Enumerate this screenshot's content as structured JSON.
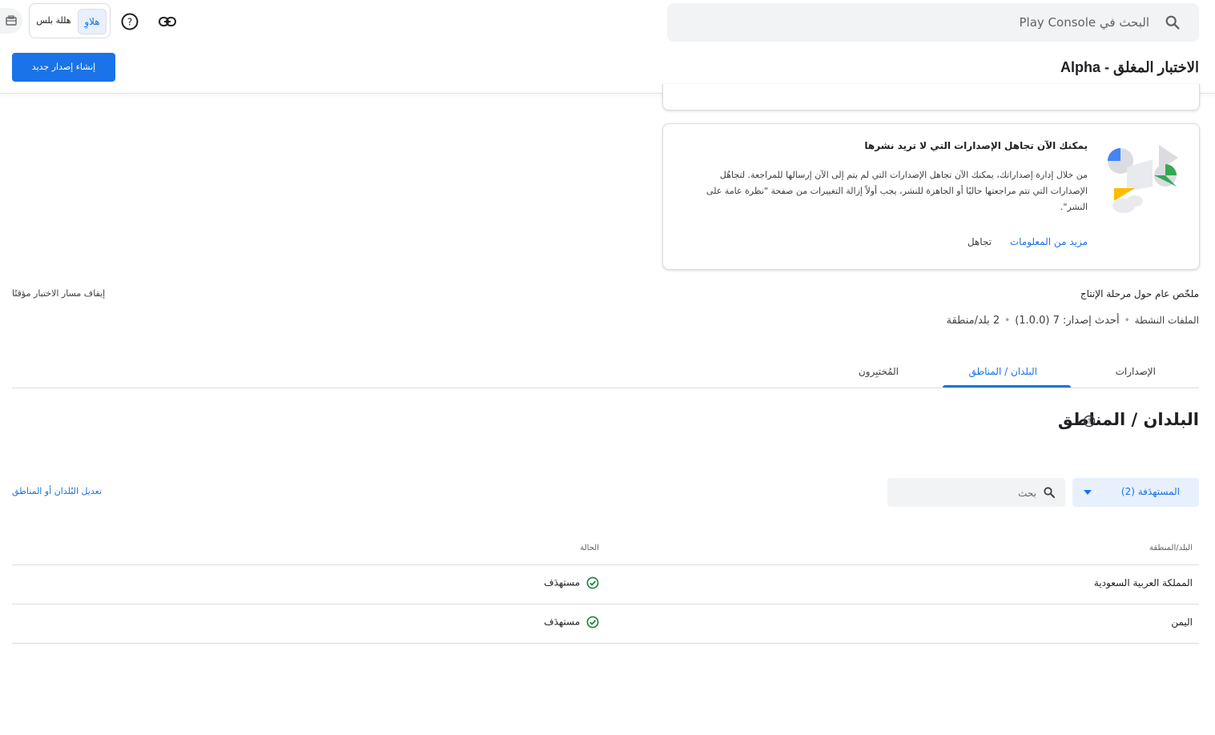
{
  "topbar": {
    "search_placeholder": "البحث في Play Console",
    "toggle_selected": "هلاوِ",
    "toggle_other": "هللة بلس",
    "icons": [
      "search-icon",
      "link-icon",
      "help-icon",
      "kit-icon"
    ]
  },
  "header": {
    "title": "الاختبار المغلق - Alpha",
    "create_button": "إنشاء إصدار جديد"
  },
  "info_card": {
    "title": "يمكنك الآن تجاهل الإصدارات التي لا تريد نشرها",
    "body": "من خلال إدارة إصداراتك، يمكنك الآن تجاهل الإصدارات التي لم يتم إلى الآن إرسالها للمراجعة. لتجاهُل الإصدارات التي تتم مراجعتها حاليًا أو الجاهزة للنشر، يجب أولاً إزالة التغييرات من صفحة \"نظرة عامة على النشر\".",
    "learn_more": "مزيد من المعلومات",
    "dismiss": "تجاهل"
  },
  "summary": {
    "title": "ملخّص عام حول مرحلة الإنتاج",
    "pause": "إيقاف مسار الاختبار مؤقتًا",
    "active_files": "الملفات النشطة",
    "latest_release": "أحدث إصدار: 7 (1.0.0)",
    "countries": "2 بلد/منطقة"
  },
  "tabs": {
    "releases": "الإصدارات",
    "countries": "البلدان / المناطق",
    "testers": "المُختبِرون",
    "active": "countries"
  },
  "section": {
    "title": "البلدان / المناطق"
  },
  "filters": {
    "select_value": "المستهدَفة (2)",
    "search_placeholder": "بحث",
    "edit_link": "تعديل البُلدان أو المناطق"
  },
  "table": {
    "headers": {
      "country": "البلد/المنطقة",
      "status": "الحالة"
    },
    "rows": [
      {
        "country": "المملكة العربية السعودية",
        "status": "مستهدَف"
      },
      {
        "country": "اليمن",
        "status": "مستهدَف"
      }
    ]
  },
  "colors": {
    "accent": "#1a73e8",
    "success": "#188038"
  }
}
